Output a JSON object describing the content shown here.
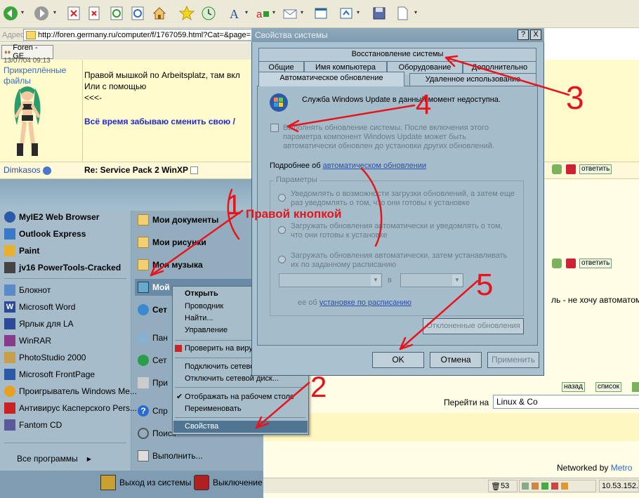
{
  "browser": {
    "address_label": "Адрес",
    "url": "http://foren.germany.ru/computer/f/1767059.html?Cat=&page=",
    "tab_title": "Foren - GE..."
  },
  "forum": {
    "partial_top": "13/07/04 09:13",
    "attachments_label": "Прикреплённые файлы",
    "post1_lines": [
      "Правой мышкой по Arbeitsplatz, там вкл",
      "Или с помощью",
      "<<<-"
    ],
    "post1_blue": "Всё время забываю сменить свою /",
    "username": "Dimkasos",
    "post_title": "Re: Service Pack 2 WinXP",
    "reply_label": "ответить",
    "right_text": "ль - не хочу автоматом",
    "nav_back": "назад",
    "nav_list": "список",
    "goto_label": "Перейти на",
    "goto_value": "Linux & Co",
    "networked_prefix": "Networked by ",
    "networked_brand": "Metro",
    "status_count": "53",
    "status_ip": "10.53.152."
  },
  "start_menu": {
    "pinned": [
      "MyIE2 Web Browser",
      "Outlook Express",
      "Paint",
      "jv16 PowerTools-Cracked"
    ],
    "recent": [
      "Блокнот",
      "Microsoft Word",
      "Ярлык для LA",
      "WinRAR",
      "PhotoStudio 2000",
      "Microsoft FrontPage",
      "Проигрыватель Windows Me...",
      "Антивирус Касперского Pers...",
      "Fantom CD"
    ],
    "all_programs": "Все программы",
    "right": [
      "Мои документы",
      "Мои рисунки",
      "Моя музыка",
      "Мой",
      "Сет",
      "Пан",
      "Сет",
      "При",
      "Спр",
      "Поиск",
      "Выполнить..."
    ],
    "logoff": "Выход из системы",
    "shutdown": "Выключение"
  },
  "context_menu": {
    "items": [
      "Открыть",
      "Проводник",
      "Найти...",
      "Управление",
      "Проверить на вирусы все",
      "Подключить сетевой диск...",
      "Отключить сетевой диск...",
      "Отображать на рабочем столе",
      "Переименовать",
      "Свойства"
    ]
  },
  "dialog": {
    "title": "Свойства системы",
    "help_btn": "?",
    "close_btn": "X",
    "tabs_row1": [
      "Восстановление системы"
    ],
    "tabs_row2": [
      "Общие",
      "Имя компьютера",
      "Оборудование",
      "Дополнительно"
    ],
    "tabs_row3": [
      "Автоматическое обновление",
      "Удаленное использование"
    ],
    "service_msg": "Служба Windows Update в данный момент недоступна.",
    "checkbox_text": "Выполнять обновление системы. После включения этого параметра компонент Windows Update может быть автоматически обновлен до установки других обновлений.",
    "more_prefix": "Подробнее об ",
    "more_link": "автоматическом обновлении",
    "params_label": "Параметры",
    "radio1": "Уведомлять о возможности загрузки обновлений, а затем еще раз уведомлять о том, что они готовы к установке",
    "radio2": "Загружать обновления автоматически и уведомлять о том, что они готовы к установке",
    "radio3": "Загружать обновления автоматически, затем устанавливать их по заданному расписанию",
    "in_label": "в",
    "schedule_prefix": "ее об ",
    "schedule_link": "установке по расписанию",
    "declined_btn": "Отклоненные обновления",
    "ok": "OK",
    "cancel": "Отмена",
    "apply": "Применить"
  },
  "annotations": {
    "caption": "Правой кнопкой",
    "numbers": [
      "1",
      "2",
      "3",
      "4",
      "5"
    ],
    "color": "#e8141c"
  }
}
